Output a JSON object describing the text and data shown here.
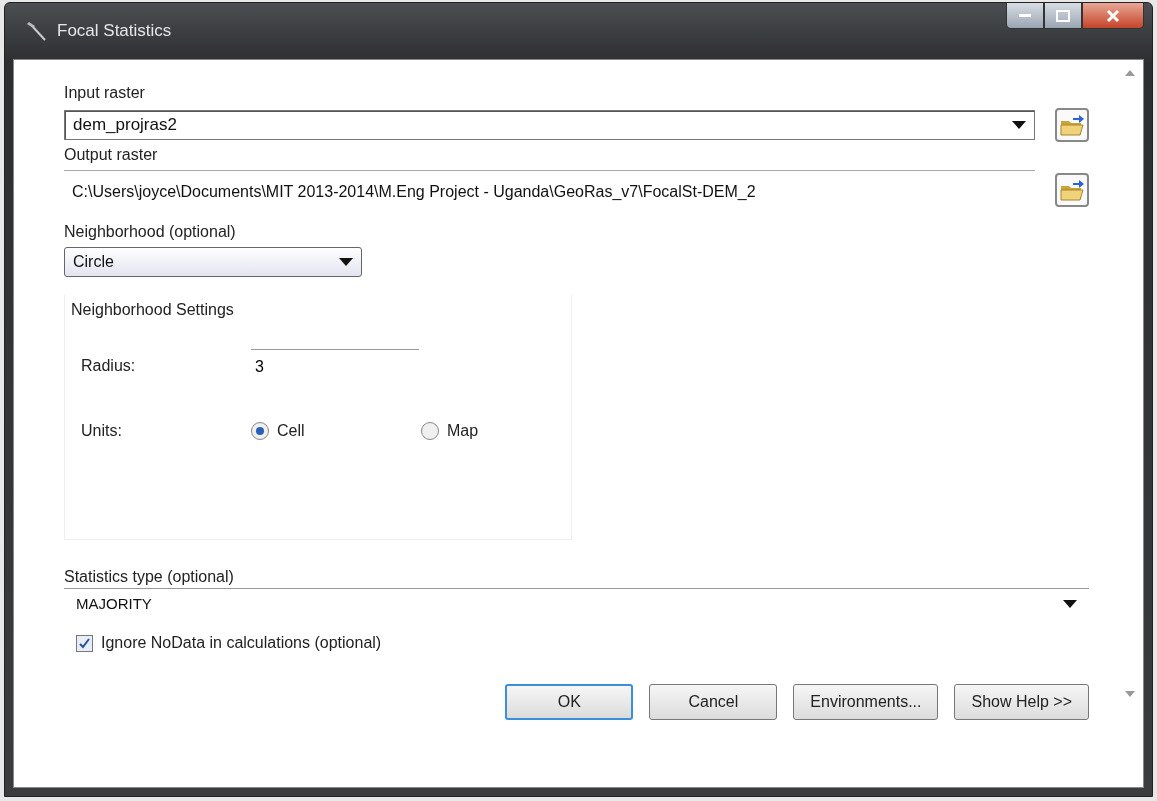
{
  "window": {
    "title": "Focal Statistics"
  },
  "input_raster": {
    "label": "Input raster",
    "value": "dem_projras2"
  },
  "output_raster": {
    "label": "Output raster",
    "value": "C:\\Users\\joyce\\Documents\\MIT 2013-2014\\M.Eng Project - Uganda\\GeoRas_v7\\FocalSt-DEM_2"
  },
  "neighborhood": {
    "label": "Neighborhood (optional)",
    "value": "Circle"
  },
  "neighborhood_settings": {
    "title": "Neighborhood Settings",
    "radius_label": "Radius:",
    "radius_value": "3",
    "units_label": "Units:",
    "units": [
      {
        "label": "Cell",
        "selected": true
      },
      {
        "label": "Map",
        "selected": false
      }
    ]
  },
  "statistics_type": {
    "label": "Statistics type (optional)",
    "value": "MAJORITY"
  },
  "ignore_nodata": {
    "label": "Ignore NoData in calculations (optional)",
    "checked": true
  },
  "buttons": [
    {
      "label": "OK",
      "default": true
    },
    {
      "label": "Cancel",
      "default": false
    },
    {
      "label": "Environments...",
      "default": false
    },
    {
      "label": "Show Help >>",
      "default": false
    }
  ]
}
